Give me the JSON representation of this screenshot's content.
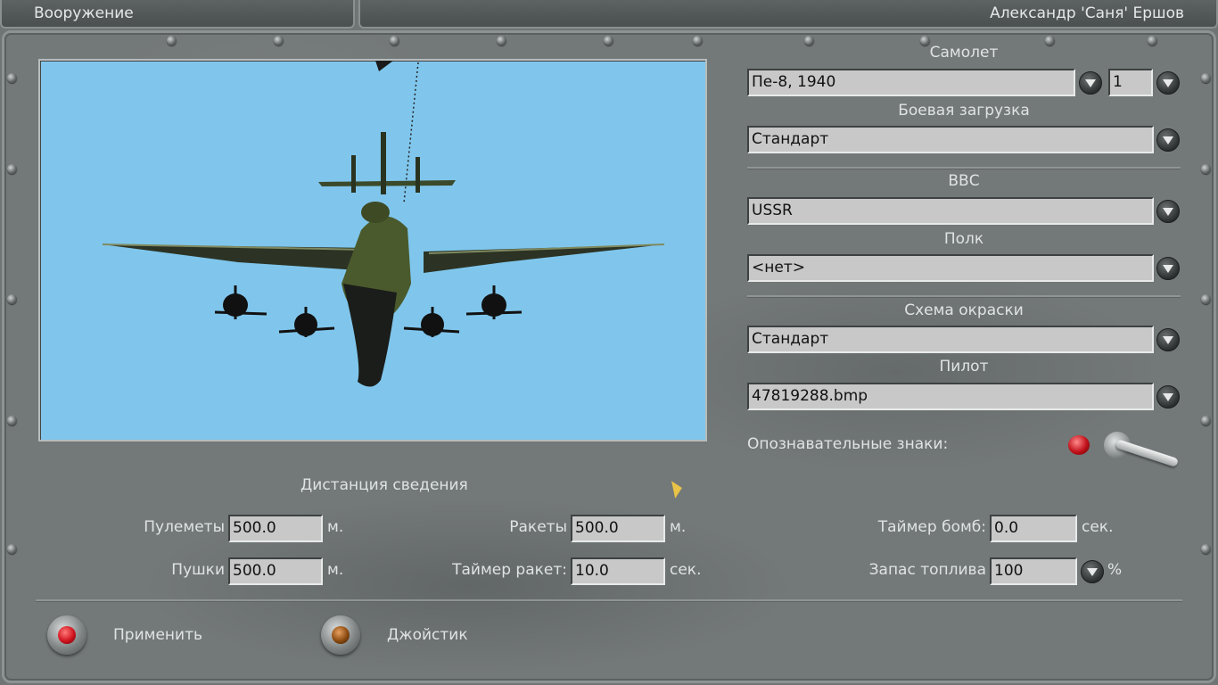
{
  "header": {
    "section_title": "Вооружение",
    "user_name": "Александр 'Саня' Ершов"
  },
  "aircraft": {
    "plane_label": "Самолет",
    "plane_value": "Пе-8, 1940",
    "plane_count": "1",
    "loadout_label": "Боевая загрузка",
    "loadout_value": "Стандарт",
    "airforce_label": "ВВС",
    "airforce_value": "USSR",
    "regiment_label": "Полк",
    "regiment_value": "<нет>",
    "skin_label": "Схема окраски",
    "skin_value": "Стандарт",
    "pilot_label": "Пилот",
    "pilot_value": "47819288.bmp",
    "markings_label": "Опознавательные знаки:"
  },
  "convergence": {
    "title": "Дистанция сведения",
    "mg_label": "Пулеметы",
    "mg_value": "500.0",
    "mg_unit": "м.",
    "cannon_label": "Пушки",
    "cannon_value": "500.0",
    "cannon_unit": "м.",
    "rockets_label": "Ракеты",
    "rockets_value": "500.0",
    "rockets_unit": "м.",
    "rocket_timer_label": "Таймер ракет:",
    "rocket_timer_value": "10.0",
    "rocket_timer_unit": "сек.",
    "bomb_timer_label": "Таймер бомб:",
    "bomb_timer_value": "0.0",
    "bomb_timer_unit": "сек.",
    "fuel_label": "Запас топлива",
    "fuel_value": "100",
    "fuel_unit": "%"
  },
  "actions": {
    "apply_label": "Применить",
    "joystick_label": "Джойстик"
  },
  "colors": {
    "sky": "#80c6ec",
    "apply_cap": "#d0141e",
    "joystick_cap": "#8a4a10"
  },
  "icons": [
    "dropdown-arrow-icon",
    "red-button-icon",
    "brown-button-icon",
    "toggle-switch-icon",
    "indicator-light-icon"
  ]
}
